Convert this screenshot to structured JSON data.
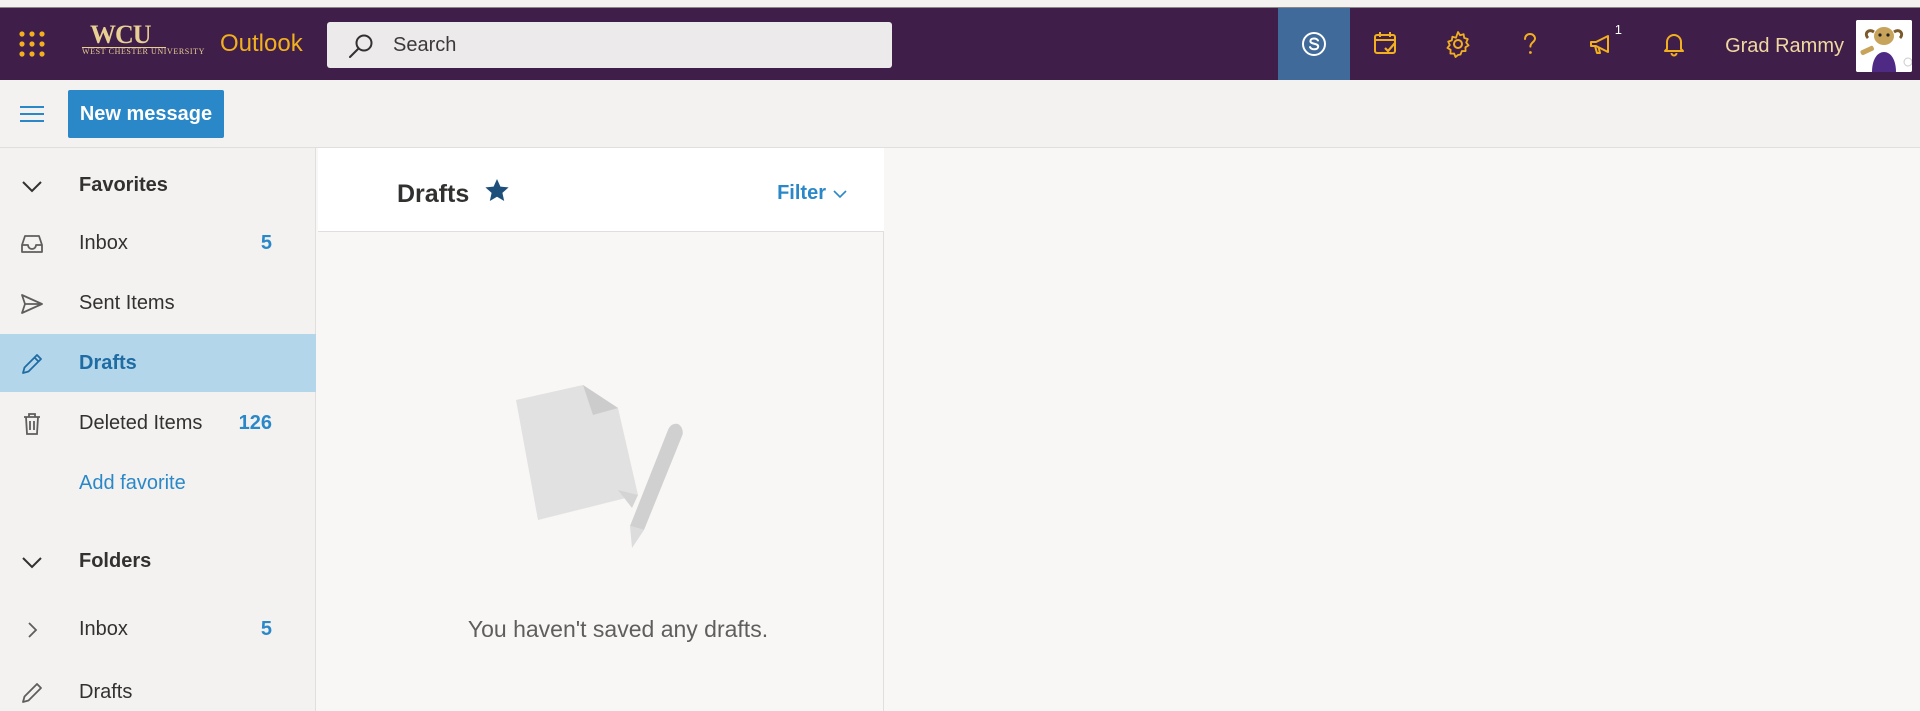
{
  "app": {
    "name": "Outlook",
    "logo_text": "WCU",
    "logo_subtext": "WEST CHESTER UNIVERSITY"
  },
  "search": {
    "placeholder": "Search"
  },
  "header": {
    "icons": [
      "skype-icon",
      "todo-calendar-icon",
      "gear-icon",
      "help-icon",
      "megaphone-icon",
      "bell-icon"
    ],
    "whats_new_badge": "1",
    "user_name": "Grad Rammy"
  },
  "command_bar": {
    "new_message_label": "New message"
  },
  "nav": {
    "favorites_label": "Favorites",
    "favorites": [
      {
        "label": "Inbox",
        "count": "5",
        "icon": "inbox-icon"
      },
      {
        "label": "Sent Items",
        "count": "",
        "icon": "send-icon"
      },
      {
        "label": "Drafts",
        "count": "",
        "icon": "pencil-icon",
        "selected": true
      },
      {
        "label": "Deleted Items",
        "count": "126",
        "icon": "trash-icon"
      }
    ],
    "add_favorite_label": "Add favorite",
    "folders_label": "Folders",
    "folders": [
      {
        "label": "Inbox",
        "count": "5",
        "icon": "chevron-right-icon"
      },
      {
        "label": "Drafts",
        "count": "",
        "icon": "pencil-icon"
      }
    ]
  },
  "list": {
    "title": "Drafts",
    "filter_label": "Filter",
    "empty_message": "You haven't saved any drafts."
  },
  "colors": {
    "header_bg": "#3f1e4a",
    "accent": "#2b88c8",
    "brand_gold": "#f2b01e",
    "selected_bg": "#b4d6eb"
  }
}
